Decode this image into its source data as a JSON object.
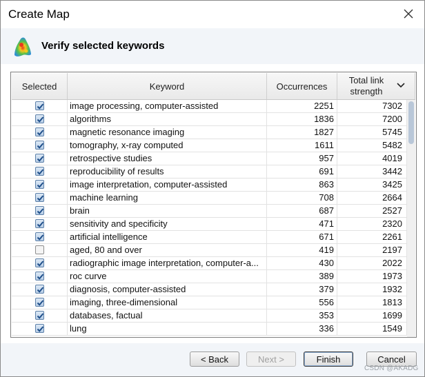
{
  "window": {
    "title": "Create Map"
  },
  "header": {
    "heading": "Verify selected keywords",
    "icon": "vosviewer-density-icon"
  },
  "table": {
    "columns": {
      "selected": "Selected",
      "keyword": "Keyword",
      "occurrences": "Occurrences",
      "total_link_strength_line1": "Total link",
      "total_link_strength_line2": "strength"
    },
    "sort": {
      "column": "total_link_strength",
      "direction": "descending"
    },
    "rows": [
      {
        "selected": true,
        "keyword": "image processing, computer-assisted",
        "occurrences": "2251",
        "total_link_strength": "7302"
      },
      {
        "selected": true,
        "keyword": "algorithms",
        "occurrences": "1836",
        "total_link_strength": "7200"
      },
      {
        "selected": true,
        "keyword": "magnetic resonance imaging",
        "occurrences": "1827",
        "total_link_strength": "5745"
      },
      {
        "selected": true,
        "keyword": "tomography, x-ray computed",
        "occurrences": "1611",
        "total_link_strength": "5482"
      },
      {
        "selected": true,
        "keyword": "retrospective studies",
        "occurrences": "957",
        "total_link_strength": "4019"
      },
      {
        "selected": true,
        "keyword": "reproducibility of results",
        "occurrences": "691",
        "total_link_strength": "3442"
      },
      {
        "selected": true,
        "keyword": "image interpretation, computer-assisted",
        "occurrences": "863",
        "total_link_strength": "3425"
      },
      {
        "selected": true,
        "keyword": "machine learning",
        "occurrences": "708",
        "total_link_strength": "2664"
      },
      {
        "selected": true,
        "keyword": "brain",
        "occurrences": "687",
        "total_link_strength": "2527"
      },
      {
        "selected": true,
        "keyword": "sensitivity and specificity",
        "occurrences": "471",
        "total_link_strength": "2320"
      },
      {
        "selected": true,
        "keyword": "artificial intelligence",
        "occurrences": "671",
        "total_link_strength": "2261"
      },
      {
        "selected": false,
        "keyword": "aged, 80 and over",
        "occurrences": "419",
        "total_link_strength": "2197"
      },
      {
        "selected": true,
        "keyword": "radiographic image interpretation, computer-a...",
        "occurrences": "430",
        "total_link_strength": "2022"
      },
      {
        "selected": true,
        "keyword": "roc curve",
        "occurrences": "389",
        "total_link_strength": "1973"
      },
      {
        "selected": true,
        "keyword": "diagnosis, computer-assisted",
        "occurrences": "379",
        "total_link_strength": "1932"
      },
      {
        "selected": true,
        "keyword": "imaging, three-dimensional",
        "occurrences": "556",
        "total_link_strength": "1813"
      },
      {
        "selected": true,
        "keyword": "databases, factual",
        "occurrences": "353",
        "total_link_strength": "1699"
      },
      {
        "selected": true,
        "keyword": "lung",
        "occurrences": "336",
        "total_link_strength": "1549"
      }
    ]
  },
  "buttons": {
    "back": "< Back",
    "next": "Next >",
    "finish": "Finish",
    "cancel": "Cancel"
  },
  "watermark": "CSDN @AKADG",
  "colors": {
    "header_band": "#f2f5f9",
    "checkbox_check": "#1f4f8a",
    "scroll_thumb": "#b9c7d8"
  }
}
